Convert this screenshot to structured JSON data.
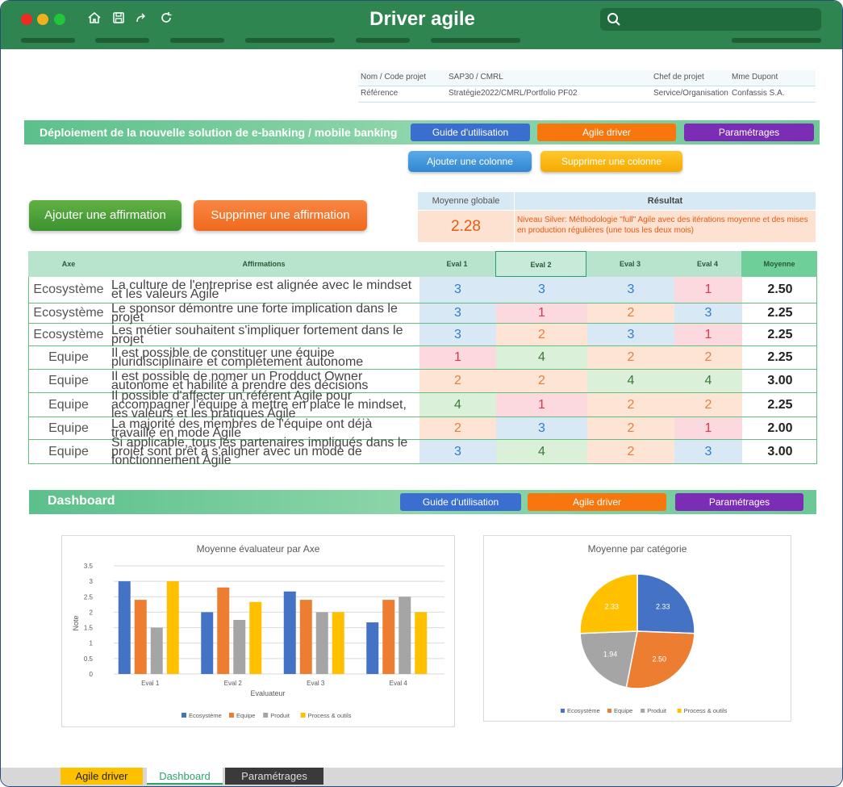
{
  "app": {
    "title": "Driver agile",
    "toolbar_icons": [
      "home-icon",
      "save-icon",
      "redo-icon",
      "refresh-icon"
    ],
    "search_icon": "search-icon"
  },
  "info": {
    "row1": {
      "label1": "Nom / Code projet",
      "value1": "SAP30 / CMRL",
      "label2": "Chef de projet",
      "value2": "Mme Dupont"
    },
    "row2": {
      "label1": "Référence",
      "value1": "Stratégie2022/CMRL/Portfolio PF02",
      "label2": "Service/Organisation",
      "value2": "Confassis S.A."
    }
  },
  "section1": {
    "title": "Déploiement de la nouvelle solution de e-banking / mobile banking",
    "btn_guide": "Guide d'utilisation",
    "btn_agile": "Agile driver",
    "btn_params": "Paramétrages",
    "btn_add_col": "Ajouter une colonne",
    "btn_del_col": "Supprimer une colonne",
    "btn_add_aff": "Ajouter une affirmation",
    "btn_del_aff": "Supprimer une affirmation"
  },
  "result": {
    "avg_label": "Moyenne globale",
    "avg_value": "2.28",
    "res_label": "Résultat",
    "res_text": "Niveau Silver: Méthodologie \"full\" Agile avec des itérations moyenne et des mises en production régulières (une tous les deux mois)"
  },
  "table": {
    "headers": {
      "axe": "Axe",
      "aff": "Affirmations",
      "e1": "Eval 1",
      "e2": "Eval 2",
      "e3": "Eval 3",
      "e4": "Eval 4",
      "moy": "Moyenne"
    },
    "rows": [
      {
        "axe": "Ecosystème",
        "aff": "La culture de l'entreprise est alignée avec le mindset et les valeurs Agile",
        "e1": "3",
        "e2": "3",
        "e3": "3",
        "e4": "1",
        "moy": "2.50"
      },
      {
        "axe": "Ecosystème",
        "aff": "Le sponsor démontre une forte implication dans le projet",
        "e1": "3",
        "e2": "1",
        "e3": "2",
        "e4": "3",
        "moy": "2.25"
      },
      {
        "axe": "Ecosystème",
        "aff": "Les métier souhaitent s'impliquer fortement dans le projet",
        "e1": "3",
        "e2": "2",
        "e3": "3",
        "e4": "1",
        "moy": "2.25"
      },
      {
        "axe": "Equipe",
        "aff": "Il est possible de constituer une équipe pluridisciplinaire et complétement autonome",
        "e1": "1",
        "e2": "4",
        "e3": "2",
        "e4": "2",
        "moy": "2.25"
      },
      {
        "axe": "Equipe",
        "aff": "Il est possible de nomer un Prodduct Owner autonome et habilité à prendre des décisions",
        "e1": "2",
        "e2": "2",
        "e3": "4",
        "e4": "4",
        "moy": "3.00"
      },
      {
        "axe": "Equipe",
        "aff": "Il possible d'affecter un référent Agile pour accompagner l'équipe à mettre en place le mindset, les valeurs et les pratiques Agile",
        "e1": "4",
        "e2": "1",
        "e3": "2",
        "e4": "2",
        "moy": "2.25"
      },
      {
        "axe": "Equipe",
        "aff": "La majorité des membres de l'équipe ont déjà travaillé en mode Agile",
        "e1": "2",
        "e2": "3",
        "e3": "2",
        "e4": "1",
        "moy": "2.00"
      },
      {
        "axe": "Equipe",
        "aff": "Si applicable, tous les partenaires impliqués dans le projet sont prêt à s'aligner avec un mode de fonctionnement Agile",
        "e1": "3",
        "e2": "4",
        "e3": "2",
        "e4": "3",
        "moy": "3.00"
      }
    ]
  },
  "section2": {
    "title": "Dashboard",
    "btn_guide": "Guide d'utilisation",
    "btn_agile": "Agile driver",
    "btn_params": "Paramétrages"
  },
  "chart_data": [
    {
      "type": "bar",
      "title": "Moyenne évaluateur par Axe",
      "xlabel": "Evaluateur",
      "ylabel": "Note",
      "ylim": [
        0,
        3.5
      ],
      "yticks": [
        "0",
        "0.5",
        "1",
        "1.5",
        "2",
        "2.5",
        "3",
        "3.5"
      ],
      "grid": true,
      "legend": "bottom",
      "categories": [
        "Eval 1",
        "Eval 2",
        "Eval 3",
        "Eval 4"
      ],
      "series": [
        {
          "name": "Ecosystème",
          "color": "#4472c4",
          "values": [
            3.0,
            2.0,
            2.67,
            1.67
          ]
        },
        {
          "name": "Equipe",
          "color": "#ed7d31",
          "values": [
            2.4,
            2.8,
            2.4,
            2.4
          ]
        },
        {
          "name": "Produit",
          "color": "#a5a5a5",
          "values": [
            1.5,
            1.75,
            2.0,
            2.5
          ]
        },
        {
          "name": "Process & outils",
          "color": "#ffc000",
          "values": [
            3.0,
            2.33,
            2.0,
            2.0
          ]
        }
      ]
    },
    {
      "type": "pie",
      "title": "Moyenne par catégorie",
      "legend": "bottom",
      "categories": [
        "Ecosystème",
        "Equipe",
        "Produit",
        "Process & outils"
      ],
      "values": [
        2.33,
        2.5,
        1.94,
        2.33
      ],
      "labels": [
        "2.33",
        "2.50",
        "1.94",
        "2.33"
      ],
      "colors": [
        "#4472c4",
        "#ed7d31",
        "#a5a5a5",
        "#ffc000"
      ]
    }
  ],
  "tabs": [
    {
      "label": "Agile driver",
      "bg": "#ffc000",
      "color": "#222222"
    },
    {
      "label": "Dashboard",
      "bg": "#ffffff",
      "color": "#2ea36d"
    },
    {
      "label": "Paramétrages",
      "bg": "#3a3a3a",
      "color": "#dddddd"
    }
  ]
}
